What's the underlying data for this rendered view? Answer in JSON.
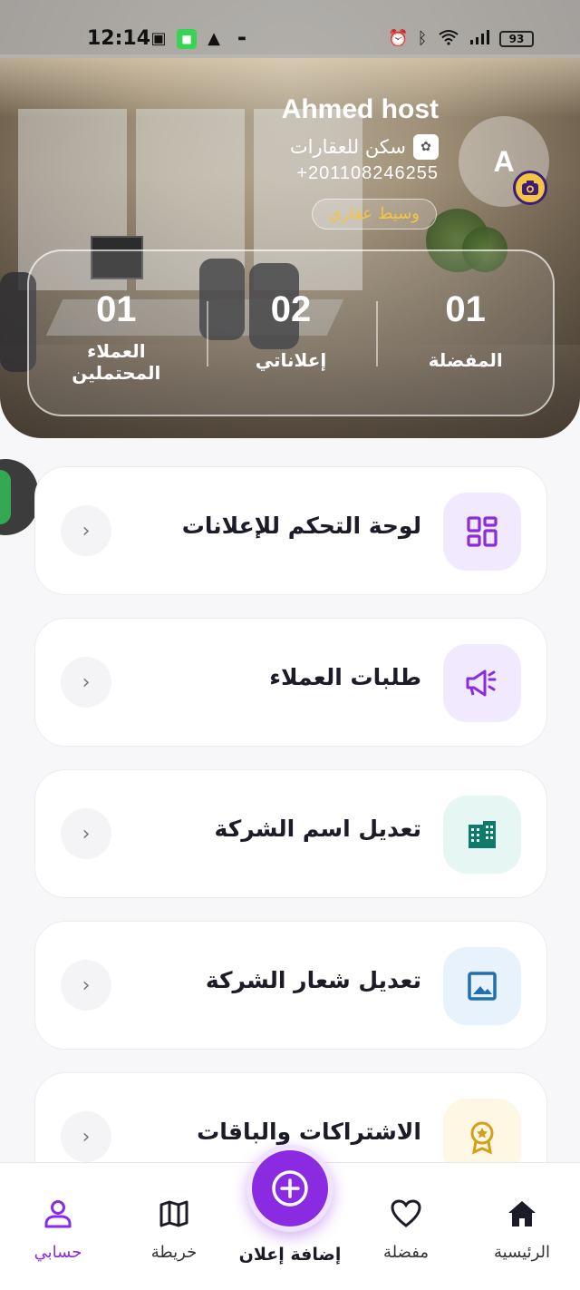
{
  "status_bar": {
    "time": "12:14",
    "battery": "93"
  },
  "profile": {
    "name": "Ahmed host",
    "company": "سكن للعقارات",
    "phone": "+201108246255",
    "role": "وسيط عقاري",
    "avatar_letter": "A"
  },
  "stats": [
    {
      "value": "01",
      "label": "المفضلة"
    },
    {
      "value": "02",
      "label": "إعلاناتي"
    },
    {
      "value": "01",
      "label": "العملاء المحتملين"
    }
  ],
  "menu": [
    {
      "label": "لوحة التحكم للإعلانات",
      "icon": "dashboard-icon",
      "icon_bg": "#f1eafe",
      "icon_color": "#8a2be2"
    },
    {
      "label": "طلبات العملاء",
      "icon": "megaphone-icon",
      "icon_bg": "#f1eafe",
      "icon_color": "#8a2be2"
    },
    {
      "label": "تعديل اسم الشركة",
      "icon": "building-icon",
      "icon_bg": "#e6f7f3",
      "icon_color": "#0f7a6a"
    },
    {
      "label": "تعديل شعار الشركة",
      "icon": "image-icon",
      "icon_bg": "#e8f2fc",
      "icon_color": "#1d6fb0"
    },
    {
      "label": "الاشتراكات والباقات",
      "icon": "award-icon",
      "icon_bg": "#fdf7e3",
      "icon_color": "#d4a017"
    }
  ],
  "bottom_nav": {
    "home": "الرئيسية",
    "favorites": "مفضلة",
    "add": "إضافة إعلان",
    "map": "خريطة",
    "account": "حسابي"
  },
  "colors": {
    "accent": "#8a2be2",
    "badge_text": "#f4c542"
  }
}
